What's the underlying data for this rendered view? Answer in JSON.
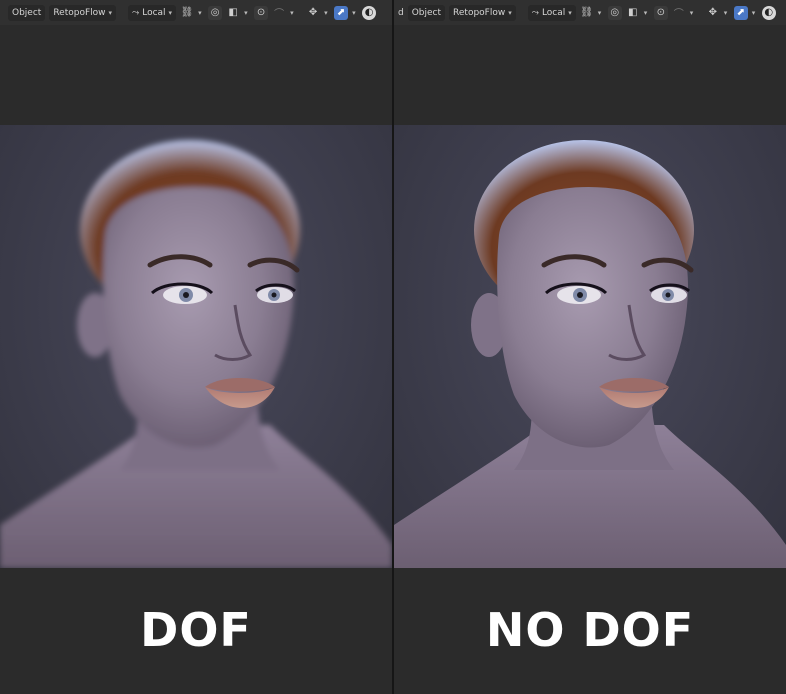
{
  "panels": [
    {
      "id": "left",
      "header": {
        "prefix": "",
        "mode_label": "Object",
        "addon_menu": "RetopoFlow",
        "orientation": "Local"
      },
      "caption": "DOF",
      "image_alt": "portrait-render-with-depth-of-field"
    },
    {
      "id": "right",
      "header": {
        "prefix": "d",
        "mode_label": "Object",
        "addon_menu": "RetopoFlow",
        "orientation": "Local"
      },
      "caption": "NO DOF",
      "image_alt": "portrait-render-without-depth-of-field"
    }
  ],
  "icons": [
    "transform-pivot-icon",
    "link-icon",
    "snap-icon",
    "cube-icon",
    "proportional-edit-icon",
    "falloff-icon",
    "gizmo-icon",
    "overlay-icon",
    "shading-icon"
  ],
  "colors": {
    "toolbar_bg": "#303030",
    "active_blue": "#4a78c6",
    "panel_bg": "#2b2b2b",
    "caption": "#ffffff"
  }
}
